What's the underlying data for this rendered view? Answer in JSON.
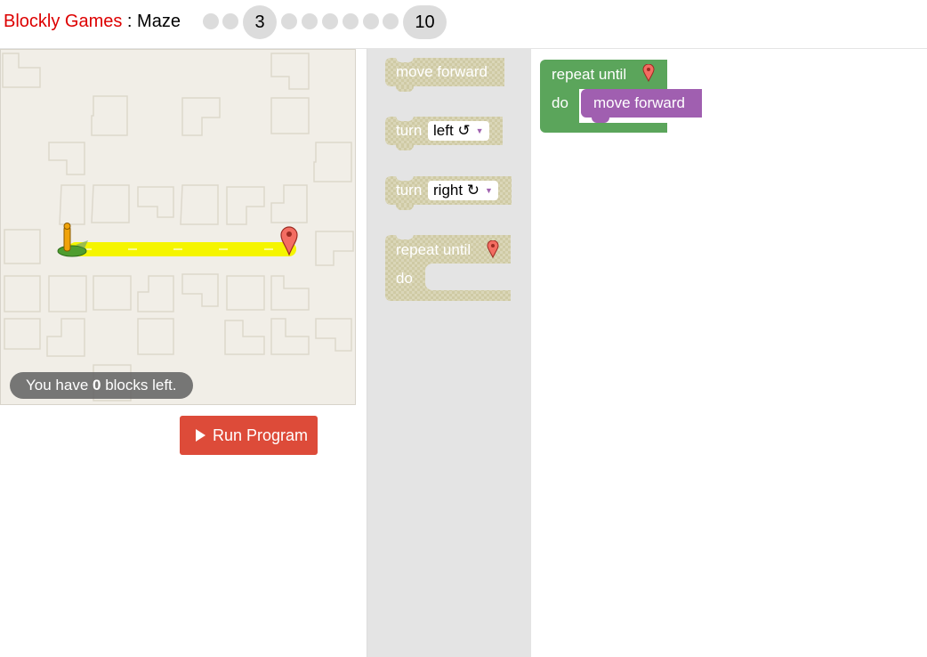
{
  "header": {
    "brand": "Blockly Games",
    "separator": " : ",
    "game": "Maze",
    "levels": [
      {
        "label": "",
        "current": false
      },
      {
        "label": "",
        "current": false
      },
      {
        "label": "3",
        "current": true
      },
      {
        "label": "",
        "current": false
      },
      {
        "label": "",
        "current": false
      },
      {
        "label": "",
        "current": false
      },
      {
        "label": "",
        "current": false
      },
      {
        "label": "",
        "current": false
      },
      {
        "label": "",
        "current": false
      },
      {
        "label": "10",
        "current": false
      }
    ]
  },
  "maze": {
    "blocks_left_prefix": "You have ",
    "blocks_left_count": "0",
    "blocks_left_suffix": " blocks left.",
    "path_color": "#f5f500",
    "start_icon": "pegman-icon",
    "goal_icon": "goal-marker-icon"
  },
  "run_button": {
    "label": "Run Program",
    "icon": "play-icon"
  },
  "toolbox": {
    "move_forward": "move forward",
    "turn_left": {
      "label": "turn",
      "option": "left ↺"
    },
    "turn_right": {
      "label": "turn",
      "option": "right ↻"
    },
    "repeat_until": {
      "label": "repeat until",
      "do": "do"
    }
  },
  "workspace": {
    "repeat_until": {
      "label": "repeat until",
      "do": "do"
    },
    "inner_block": "move forward"
  },
  "colors": {
    "brand_red": "#dd0000",
    "run_button": "#dd4b39",
    "loop_block": "#5ba55b",
    "action_block": "#a05fb0",
    "toolbox_block": "#cfcaa4"
  }
}
